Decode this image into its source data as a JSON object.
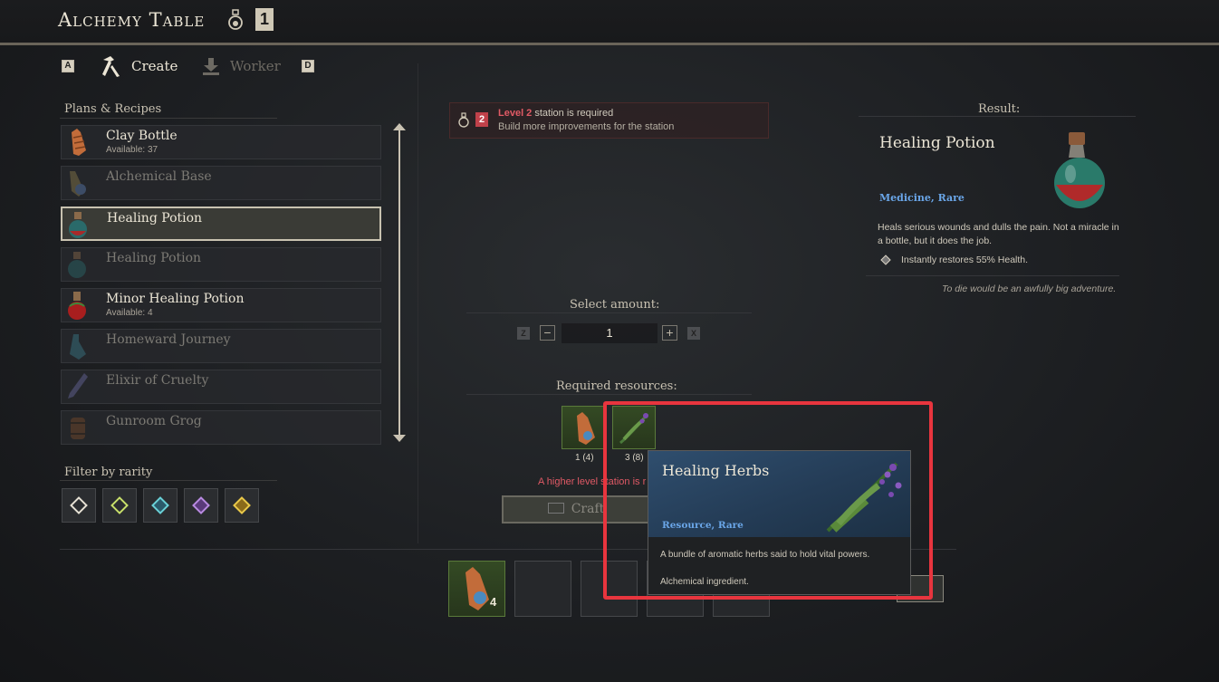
{
  "header": {
    "title": "Alchemy Table",
    "level": "1"
  },
  "tabs": {
    "left_key": "A",
    "create_label": "Create",
    "worker_label": "Worker",
    "right_key": "D"
  },
  "recipes": {
    "title": "Plans & Recipes",
    "items": [
      {
        "name": "Clay Bottle",
        "available": "Available: 37"
      },
      {
        "name": "Alchemical Base",
        "available": ""
      },
      {
        "name": "Healing Potion",
        "available": ""
      },
      {
        "name": "Healing Potion",
        "available": ""
      },
      {
        "name": "Minor Healing Potion",
        "available": "Available: 4"
      },
      {
        "name": "Homeward Journey",
        "available": ""
      },
      {
        "name": "Elixir of Cruelty",
        "available": ""
      },
      {
        "name": "Gunroom Grog",
        "available": ""
      }
    ]
  },
  "filter": {
    "title": "Filter by rarity"
  },
  "warning": {
    "level_number": "2",
    "level_text": "Level 2",
    "line1_rest": " station is required",
    "line2": "Build more improvements for the station"
  },
  "amount": {
    "title": "Select amount:",
    "dec_key": "Z",
    "inc_key": "X",
    "value": "1"
  },
  "required": {
    "title": "Required resources:",
    "counts": [
      "1 (4)",
      "3 (8)"
    ],
    "higher_level_text": "A higher level station is r"
  },
  "craft": {
    "label": "Craft"
  },
  "inventory": {
    "first_count": "4"
  },
  "result": {
    "title": "Result:",
    "name": "Healing Potion",
    "type": "Medicine, Rare",
    "description": "Heals serious wounds and dulls the pain. Not a miracle in a bottle, but it does the job.",
    "effect": "Instantly restores 55% Health.",
    "quote": "To die would be an awfully big adventure."
  },
  "tooltip": {
    "name": "Healing Herbs",
    "type": "Resource, Rare",
    "description": "A bundle of aromatic herbs said to hold vital powers.",
    "footer": "Alchemical ingredient."
  },
  "colors": {
    "highlight": "#e8353e",
    "rare_blue": "#6aa6e8",
    "warning_red": "#e05a65"
  }
}
